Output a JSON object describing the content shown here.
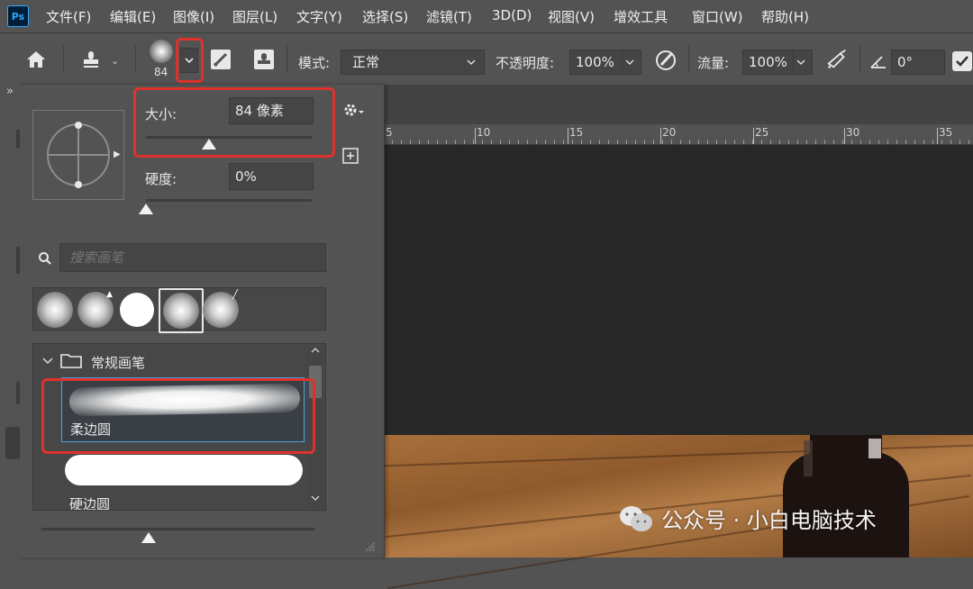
{
  "app": {
    "logo": "Ps"
  },
  "menu": [
    "文件(F)",
    "编辑(E)",
    "图像(I)",
    "图层(L)",
    "文字(Y)",
    "选择(S)",
    "滤镜(T)",
    "3D(D)",
    "视图(V)",
    "增效工具",
    "窗口(W)",
    "帮助(H)"
  ],
  "options": {
    "brush_size_value": "84",
    "mode_label": "模式:",
    "mode_value": "正常",
    "opacity_label": "不透明度:",
    "opacity_value": "100%",
    "flow_label": "流量:",
    "flow_value": "100%",
    "angle_value": "0°"
  },
  "collapse_glyph": "»",
  "brush_panel": {
    "size_label": "大小:",
    "size_value": "84 像素",
    "size_fraction": 0.38,
    "hardness_label": "硬度:",
    "hardness_value": "0%",
    "hardness_fraction": 0.0,
    "search_placeholder": "搜索画笔",
    "folder_name": "常规画笔",
    "brushes": [
      {
        "name": "柔边圆",
        "selected": true
      },
      {
        "name": "硬边圆",
        "selected": false
      }
    ]
  },
  "ruler": {
    "labels": [
      "5",
      "10",
      "15",
      "20",
      "25",
      "30",
      "35"
    ]
  },
  "watermark": {
    "text": "公众号 · 小白电脑技术"
  },
  "colors": {
    "highlight": "#e0322c",
    "selection": "#4aa0e6",
    "app_bg": "#535353",
    "canvas_bg": "#282828"
  }
}
